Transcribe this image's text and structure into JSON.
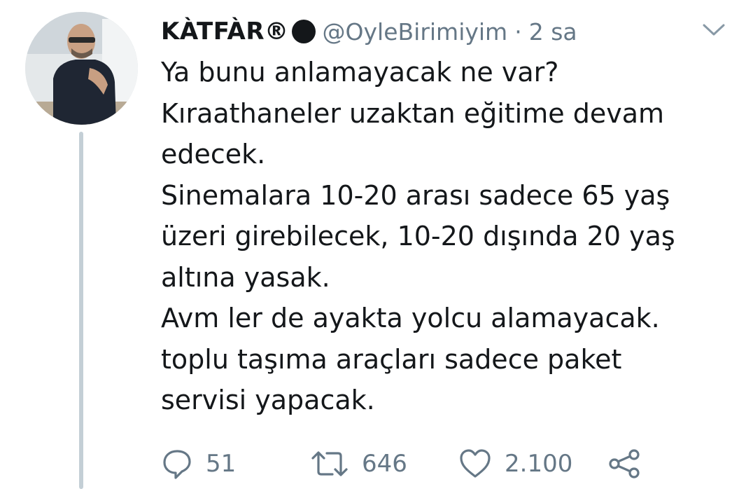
{
  "tweet": {
    "author_name": "KÀTFÀR®",
    "author_handle": "@OyleBirimiyim",
    "separator": "·",
    "timestamp": "2 sa",
    "text_lines": [
      "Ya bunu anlamayacak ne var?",
      "Kıraathaneler uzaktan eğitime devam",
      "edecek.",
      "Sinemalara 10-20 arası sadece 65 yaş",
      "üzeri girebilecek, 10-20 dışında 20 yaş",
      "altına yasak.",
      "Avm ler de ayakta yolcu alamayacak.",
      "toplu taşıma araçları sadece paket",
      "servisi yapacak."
    ],
    "reply_count": "51",
    "retweet_count": "646",
    "like_count": "2.100"
  },
  "icons": {
    "reply": "reply-icon",
    "retweet": "retweet-icon",
    "like": "heart-icon",
    "share": "share-icon",
    "menu": "chevron-down-icon",
    "badge": "black-circle-icon"
  },
  "colors": {
    "text_primary": "#14171a",
    "text_secondary": "#657786",
    "thread_line": "#c4cfd6",
    "icon": "#657786"
  }
}
